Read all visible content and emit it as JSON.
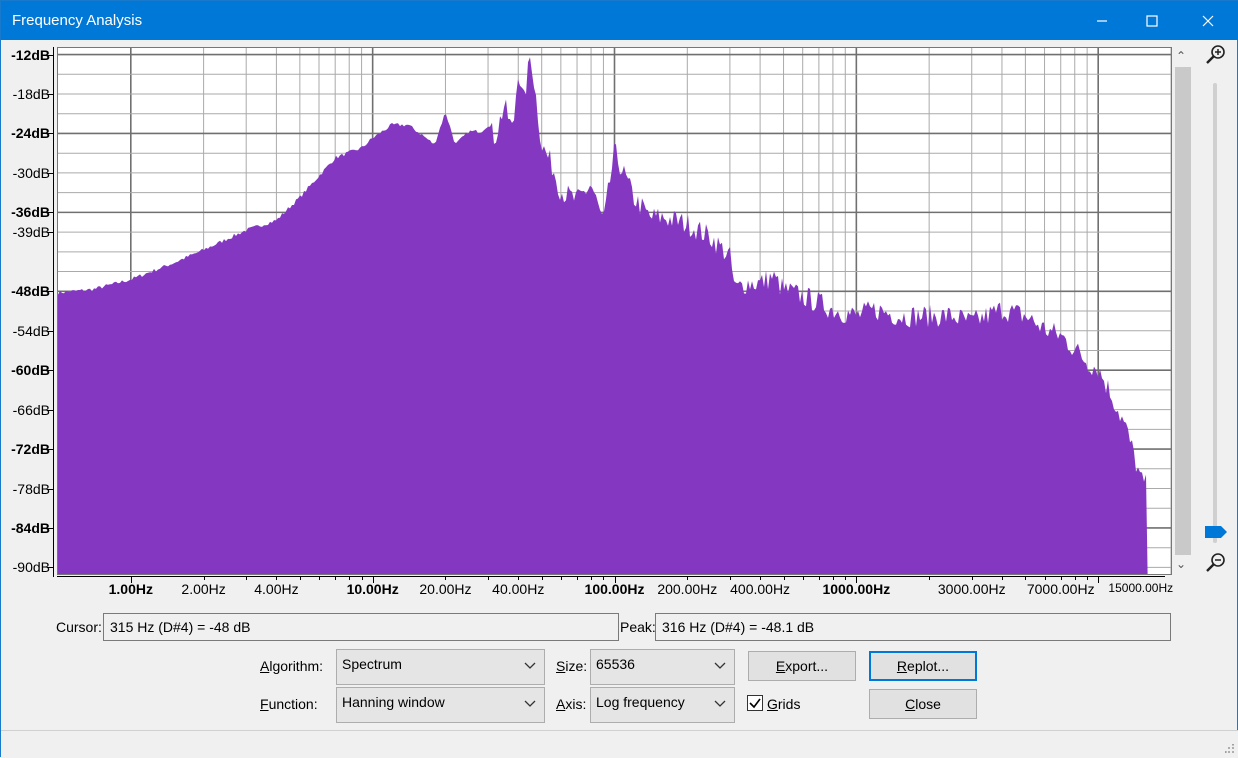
{
  "window": {
    "title": "Frequency Analysis"
  },
  "colors": {
    "spectrum_fill": "#8437c1",
    "grid": "#aaaaaa",
    "titlebar": "#0078d7"
  },
  "icons": {
    "minimize": "minimize-icon",
    "maximize": "maximize-icon",
    "close": "close-icon",
    "zoom_in": "zoom-in-icon",
    "zoom_out": "zoom-out-icon"
  },
  "chart_data": {
    "type": "area",
    "x_scale": "log",
    "xlim": [
      0.5,
      20000
    ],
    "ylim": [
      -91,
      -11
    ],
    "y_ticks": [
      "-12dB",
      "-18dB",
      "-24dB",
      "-30dB",
      "-36dB",
      "-39dB",
      "-48dB",
      "-54dB",
      "-60dB",
      "-66dB",
      "-72dB",
      "-78dB",
      "-84dB",
      "-90dB"
    ],
    "y_tick_values": [
      -12,
      -18,
      -24,
      -30,
      -36,
      -39,
      -48,
      -54,
      -60,
      -66,
      -72,
      -78,
      -84,
      -90
    ],
    "x_ticks": [
      "1.00Hz",
      "2.00Hz",
      "4.00Hz",
      "10.00Hz",
      "20.00Hz",
      "40.00Hz",
      "100.00Hz",
      "200.00Hz",
      "400.00Hz",
      "1000.00Hz",
      "3000.00Hz",
      "7000.00Hz",
      "15000.00Hz"
    ],
    "x_tick_values": [
      1,
      2,
      4,
      10,
      20,
      40,
      100,
      200,
      400,
      1000,
      3000,
      7000,
      15000
    ],
    "grid": true,
    "x": [
      0.5,
      0.7,
      1,
      1.5,
      2,
      3,
      4,
      5,
      7,
      9,
      10,
      12,
      14,
      16,
      18,
      20,
      22,
      25,
      28,
      30,
      32,
      35,
      38,
      40,
      42,
      45,
      50,
      55,
      60,
      70,
      80,
      90,
      100,
      120,
      140,
      160,
      200,
      250,
      300,
      315,
      350,
      400,
      450,
      500,
      600,
      700,
      800,
      1000,
      1200,
      1500,
      2000,
      2500,
      3000,
      4000,
      5000,
      6000,
      7000,
      8000,
      9000,
      10000,
      11000,
      12000,
      13000,
      14000,
      15000,
      16000
    ],
    "y": [
      -48.5,
      -48,
      -46.5,
      -44,
      -42,
      -39,
      -37.5,
      -34,
      -28,
      -26.5,
      -25,
      -23,
      -23,
      -24.5,
      -26,
      -21,
      -26,
      -24,
      -24,
      -23,
      -25,
      -20,
      -24,
      -14,
      -20,
      -12,
      -26,
      -29,
      -33,
      -34.5,
      -32,
      -38,
      -27,
      -34,
      -37,
      -37,
      -38,
      -40,
      -43,
      -48,
      -47,
      -47,
      -46,
      -48,
      -49,
      -50,
      -51,
      -52,
      -51,
      -52,
      -52,
      -52,
      -53,
      -51,
      -52,
      -54,
      -55,
      -57,
      -59,
      -60,
      -63,
      -66,
      -69,
      -73,
      -77,
      -78
    ]
  },
  "readouts": {
    "cursor_label": "Cursor:",
    "cursor_value": "315 Hz (D#4) = -48 dB",
    "peak_label": "Peak:",
    "peak_value": "316 Hz (D#4) = -48.1 dB"
  },
  "controls": {
    "algorithm_label_u": "A",
    "algorithm_label_rest": "lgorithm:",
    "algorithm_value": "Spectrum",
    "function_label_u": "F",
    "function_label_rest": "unction:",
    "function_value": "Hanning window",
    "size_label_u": "S",
    "size_label_rest": "ize:",
    "size_value": "65536",
    "axis_label_u": "A",
    "axis_label_rest": "xis:",
    "axis_value": "Log frequency",
    "export_u": "E",
    "export_rest": "xport...",
    "replot_u": "R",
    "replot_rest": "eplot...",
    "close_u": "C",
    "close_rest": "lose",
    "grids_u": "G",
    "grids_rest": "rids",
    "grids_checked": true
  }
}
